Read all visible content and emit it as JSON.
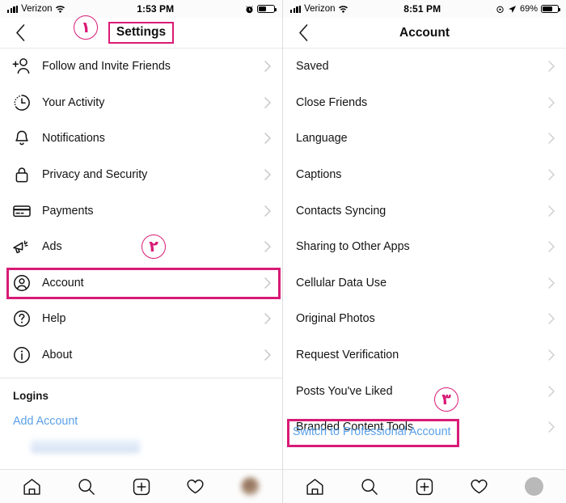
{
  "colors": {
    "accent_pink": "#d81b76",
    "link_blue": "#5aa0e8",
    "text": "#131313",
    "chevron_gray": "#c7c7c7",
    "divider": "#e4e4e4"
  },
  "left_phone": {
    "status_bar": {
      "carrier": "Verizon",
      "time": "1:53 PM",
      "battery_percent": "",
      "signal_icon": "signal-bars-icon",
      "wifi_icon": "wifi-icon",
      "alarm_icon": "alarm-clock-icon",
      "battery_icon": "battery-icon",
      "battery_level": 48
    },
    "nav": {
      "back_icon": "chevron-left-icon",
      "title": "Settings"
    },
    "items": [
      {
        "label": "Follow and Invite Friends",
        "icon": "add-person-icon"
      },
      {
        "label": "Your Activity",
        "icon": "activity-clock-icon"
      },
      {
        "label": "Notifications",
        "icon": "bell-icon"
      },
      {
        "label": "Privacy and Security",
        "icon": "lock-icon"
      },
      {
        "label": "Payments",
        "icon": "credit-card-icon"
      },
      {
        "label": "Ads",
        "icon": "megaphone-icon"
      },
      {
        "label": "Account",
        "icon": "account-circle-icon"
      },
      {
        "label": "Help",
        "icon": "question-circle-icon"
      },
      {
        "label": "About",
        "icon": "info-circle-icon"
      }
    ],
    "logins": {
      "section_title": "Logins",
      "add_account_label": "Add Account",
      "blurred_entry": ""
    },
    "tabbar": {
      "items": [
        {
          "icon": "home-icon"
        },
        {
          "icon": "search-icon"
        },
        {
          "icon": "new-post-plus-icon"
        },
        {
          "icon": "heart-icon"
        },
        {
          "icon": "profile-avatar-icon"
        }
      ]
    }
  },
  "right_phone": {
    "status_bar": {
      "carrier": "Verizon",
      "time": "8:51 PM",
      "battery_percent": "69%",
      "signal_icon": "signal-bars-icon",
      "wifi_icon": "wifi-icon",
      "alarm_icon": "alarm-clock-icon",
      "location_icon": "location-arrow-icon",
      "battery_icon": "battery-icon",
      "battery_level": 69
    },
    "nav": {
      "back_icon": "chevron-left-icon",
      "title": "Account"
    },
    "items": [
      {
        "label": "Saved"
      },
      {
        "label": "Close Friends"
      },
      {
        "label": "Language"
      },
      {
        "label": "Captions"
      },
      {
        "label": "Contacts Syncing"
      },
      {
        "label": "Sharing to Other Apps"
      },
      {
        "label": "Cellular Data Use"
      },
      {
        "label": "Original Photos"
      },
      {
        "label": "Request Verification"
      },
      {
        "label": "Posts You've Liked"
      },
      {
        "label": "Branded Content Tools"
      }
    ],
    "switch_link": "Switch to Professional Account",
    "tabbar": {
      "items": [
        {
          "icon": "home-icon"
        },
        {
          "icon": "search-icon"
        },
        {
          "icon": "new-post-plus-icon"
        },
        {
          "icon": "heart-icon"
        },
        {
          "icon": "profile-avatar-icon"
        }
      ]
    }
  },
  "annotations": {
    "markers": [
      {
        "id": 1,
        "glyph": "۱",
        "target": "settings-title"
      },
      {
        "id": 2,
        "glyph": "۲",
        "target": "account-row"
      },
      {
        "id": 3,
        "glyph": "۳",
        "target": "switch-to-professional-account"
      }
    ],
    "highlight_boxes": [
      {
        "target": "settings-title"
      },
      {
        "target": "account-row"
      },
      {
        "target": "switch-to-professional-account"
      }
    ]
  }
}
